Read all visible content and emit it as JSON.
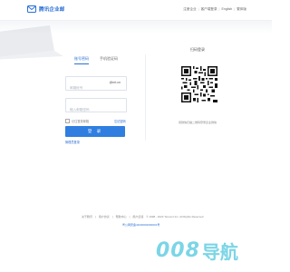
{
  "header": {
    "brand": "腾讯企业邮",
    "links": [
      "注册企业",
      "客户端登录",
      "English",
      "繁体版"
    ]
  },
  "login": {
    "tabs": [
      "账号密码",
      "手机验证码"
    ],
    "account_placeholder": "邮箱帐号",
    "account_suffix": "@mt.cn",
    "password_placeholder": "输入邮箱密码",
    "remember_label": "记住登录邮箱",
    "forgot_label": "忘记密码",
    "login_button": "登 录",
    "register_label": "管理员登录"
  },
  "qr": {
    "title": "扫码登录",
    "caption": "用微信扫描二维码登录企业微信"
  },
  "footer": {
    "links": [
      "关于腾讯",
      "用户协议",
      "帮助中心",
      "用户反馈",
      "© 1998 - 2023 Tencent Inc. All Rights Reserved"
    ],
    "icp": "粤公网安备44030002000001号"
  },
  "watermark": {
    "num": "008",
    "text": "导航"
  },
  "colors": {
    "accent": "#2a6fd6",
    "button": "#2f7ee0",
    "watermark": "#7bd5e6"
  }
}
